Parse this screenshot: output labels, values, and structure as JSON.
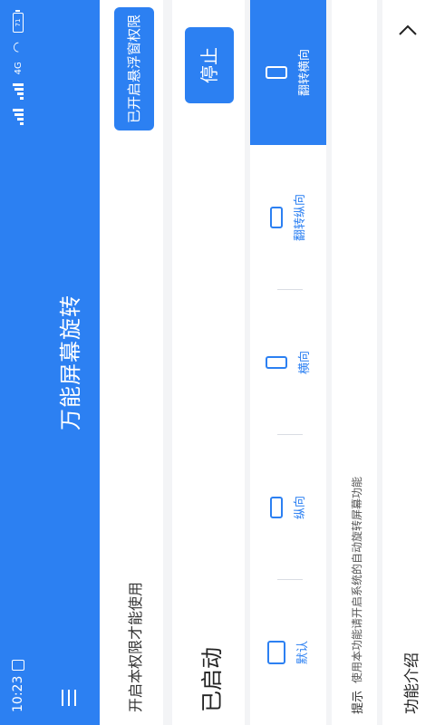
{
  "status_bar": {
    "time": "10:23",
    "network": "4G",
    "battery": "71"
  },
  "app": {
    "title": "万能屏幕旋转"
  },
  "permission": {
    "text": "开启本权限才能使用",
    "button_label": "已开启悬浮窗权限"
  },
  "service": {
    "status": "已启动",
    "stop_label": "停止"
  },
  "modes": [
    {
      "label": "默认",
      "icon": "device-landscape-icon"
    },
    {
      "label": "纵向",
      "icon": "device-landscape-icon"
    },
    {
      "label": "横向",
      "icon": "device-portrait-icon"
    },
    {
      "label": "翻转纵向",
      "icon": "device-landscape-icon"
    },
    {
      "label": "翻转横向",
      "icon": "device-portrait-icon",
      "active": true
    }
  ],
  "hint": {
    "label": "提示",
    "text": "使用本功能请开启系统的自动旋转屏幕功能"
  },
  "feature": {
    "label": "功能介绍"
  },
  "colors": {
    "accent": "#2c80f2",
    "background": "#f3f4f6"
  }
}
